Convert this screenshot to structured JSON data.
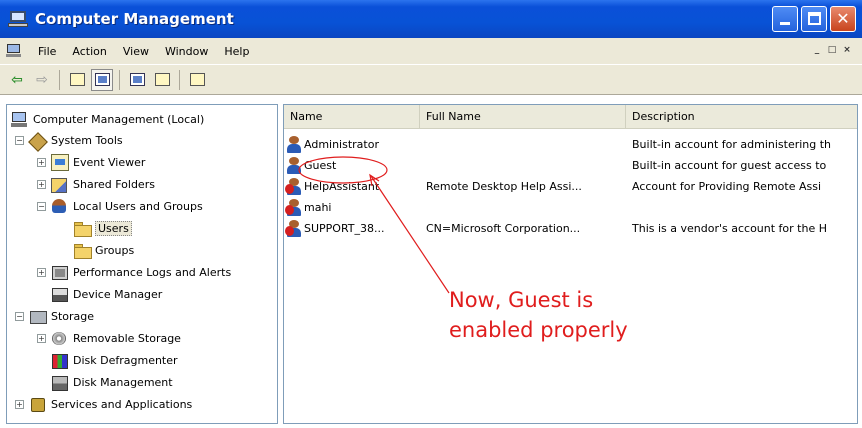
{
  "window": {
    "title": "Computer Management",
    "title_icon": "computer-management-icon"
  },
  "menubar": {
    "items": [
      "File",
      "Action",
      "View",
      "Window",
      "Help"
    ],
    "mdi_buttons": [
      "_",
      "□",
      "×"
    ]
  },
  "toolbar": {
    "buttons": [
      "back-icon",
      "forward-icon",
      "up-folder-icon",
      "show-hide-tree-icon",
      "properties-icon",
      "export-list-icon",
      "help-icon"
    ]
  },
  "tree": {
    "root": "Computer Management (Local)",
    "items": [
      {
        "label": "System Tools",
        "icon": "tools-icon",
        "expander": "−"
      },
      {
        "label": "Event Viewer",
        "icon": "event-viewer-icon",
        "expander": "+"
      },
      {
        "label": "Shared Folders",
        "icon": "shared-folders-icon",
        "expander": "+"
      },
      {
        "label": "Local Users and Groups",
        "icon": "users-groups-icon",
        "expander": "−"
      },
      {
        "label": "Users",
        "icon": "folder-icon"
      },
      {
        "label": "Groups",
        "icon": "folder-icon"
      },
      {
        "label": "Performance Logs and Alerts",
        "icon": "performance-icon",
        "expander": "+"
      },
      {
        "label": "Device Manager",
        "icon": "device-manager-icon"
      },
      {
        "label": "Storage",
        "icon": "storage-icon",
        "expander": "−"
      },
      {
        "label": "Removable Storage",
        "icon": "removable-storage-icon",
        "expander": "+"
      },
      {
        "label": "Disk Defragmenter",
        "icon": "disk-defragmenter-icon"
      },
      {
        "label": "Disk Management",
        "icon": "disk-management-icon"
      },
      {
        "label": "Services and Applications",
        "icon": "services-icon",
        "expander": "+"
      }
    ],
    "selected": "Users"
  },
  "list": {
    "columns": [
      "Name",
      "Full Name",
      "Description"
    ],
    "rows": [
      {
        "name": "Administrator",
        "full_name": "",
        "description": "Built-in account for administering th",
        "disabled": false
      },
      {
        "name": "Guest",
        "full_name": "",
        "description": "Built-in account for guest access to",
        "disabled": false
      },
      {
        "name": "HelpAssistant",
        "full_name": "Remote Desktop Help Assi...",
        "description": "Account for Providing Remote Assi",
        "disabled": true
      },
      {
        "name": "mahi",
        "full_name": "",
        "description": "",
        "disabled": true
      },
      {
        "name": "SUPPORT_38...",
        "full_name": "CN=Microsoft Corporation...",
        "description": "This is a vendor's account for the H",
        "disabled": true
      }
    ]
  },
  "annotation": {
    "line1": "Now, Guest is",
    "line2": "enabled properly",
    "color": "#e01d1d"
  }
}
